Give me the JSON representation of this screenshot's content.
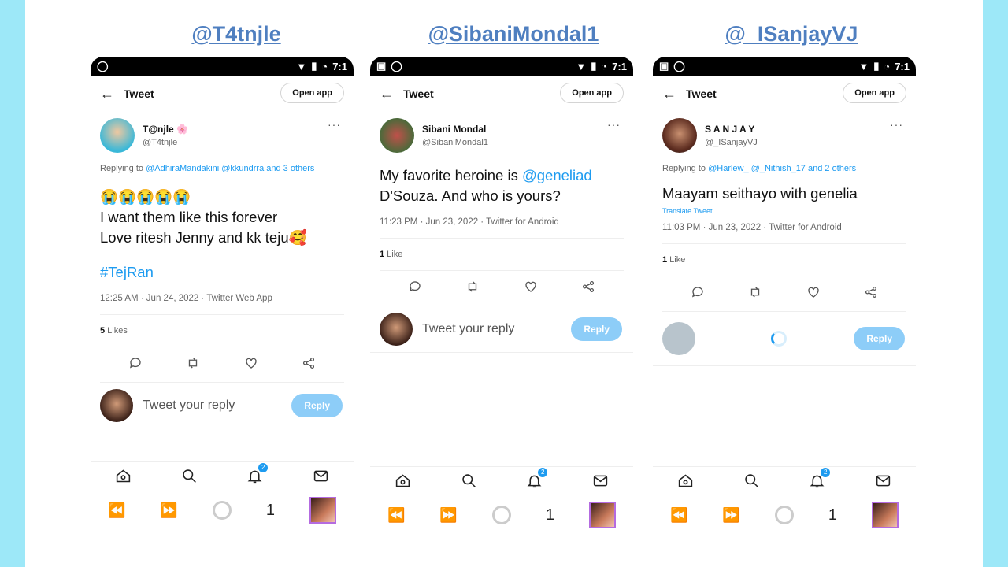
{
  "handles": [
    "@T4tnjle",
    "@SibaniMondal1",
    "@_ISanjayVJ"
  ],
  "status_bar": {
    "time": "7:1"
  },
  "common": {
    "back_glyph": "←",
    "tweet_title": "Tweet",
    "open_app": "Open app",
    "more": "···",
    "reply_placeholder": "Tweet your reply",
    "reply_button": "Reply",
    "nav_badge": "2",
    "bottom_count": "1"
  },
  "phones": [
    {
      "author_name": "T@njle 🌸",
      "author_handle": "@T4tnjle",
      "replying_label": "Replying to ",
      "replying_to": "@AdhiraMandakini @kkundrra and 3 others",
      "emoji_line": "😭😭😭😭😭",
      "text_line1": "I want them like this forever",
      "text_line2": "Love ritesh Jenny and kk teju🥰",
      "hashtag": "#TejRan",
      "meta": "12:25 AM · Jun 24, 2022 · Twitter Web App",
      "likes_count": "5",
      "likes_label": " Likes"
    },
    {
      "author_name": "Sibani Mondal",
      "author_handle": "@SibaniMondal1",
      "text_part1": "My favorite heroine is ",
      "text_mention": "@geneliad",
      "text_part2": "D'Souza. And who is yours?",
      "meta": "11:23 PM · Jun 23, 2022 · Twitter for Android",
      "likes_count": "1",
      "likes_label": " Like"
    },
    {
      "author_name": "S A N J A Y",
      "author_handle": "@_ISanjayVJ",
      "replying_label": "Replying to ",
      "replying_to": "@Harlew_ @_Nithish_17 and 2 others",
      "text": "Maayam seithayo with genelia",
      "translate": "Translate Tweet",
      "meta": "11:03 PM · Jun 23, 2022 · Twitter for Android",
      "likes_count": "1",
      "likes_label": " Like"
    }
  ],
  "colors": {
    "accent": "#1d9bf0",
    "handle_title": "#4f7fc0",
    "background": "#9de8f8",
    "reply_button": "#8dcdf8"
  },
  "icons": [
    "back-arrow-icon",
    "reply-icon",
    "retweet-icon",
    "like-icon",
    "share-icon",
    "home-icon",
    "search-icon",
    "notifications-icon",
    "messages-icon",
    "rewind-icon",
    "forward-icon"
  ]
}
